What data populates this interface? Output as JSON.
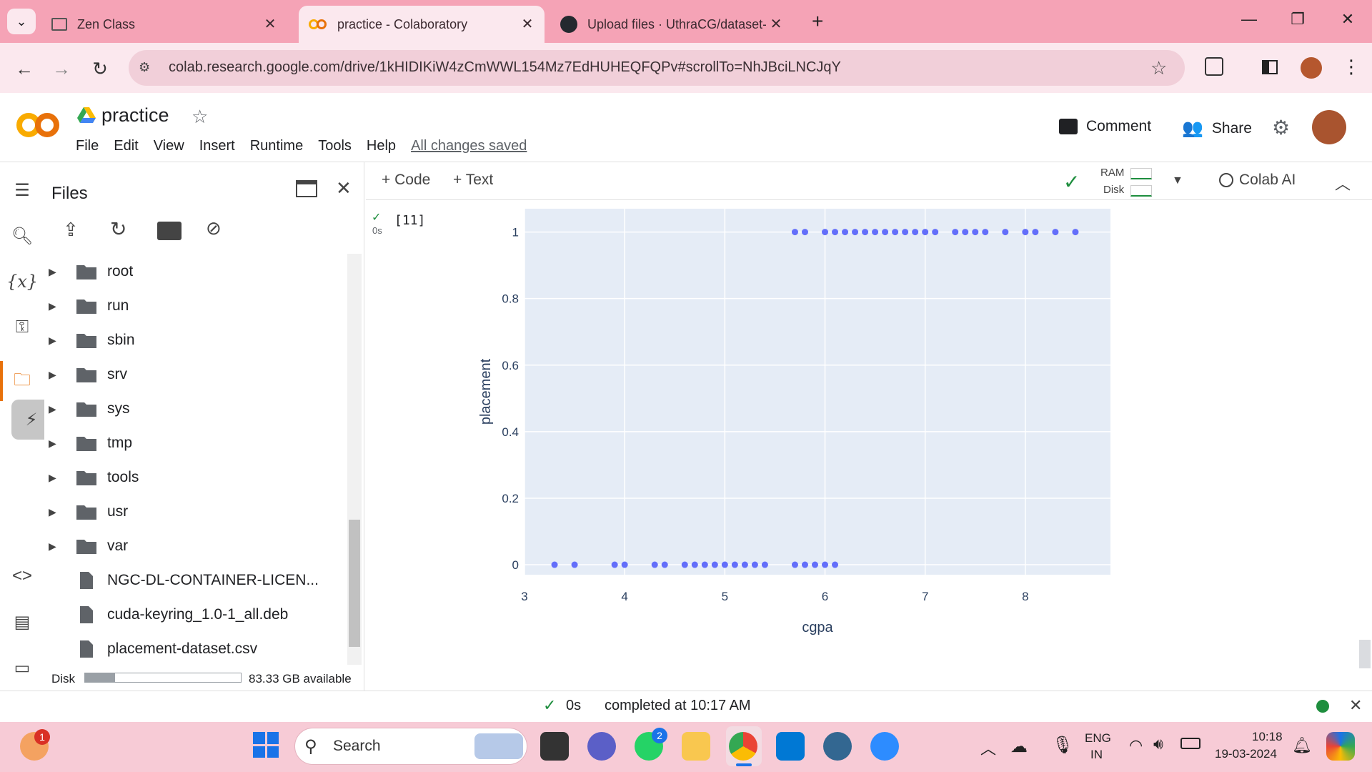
{
  "browser": {
    "tabs": [
      {
        "title": "Zen Class",
        "active": false
      },
      {
        "title": "practice - Colaboratory",
        "active": true
      },
      {
        "title": "Upload files · UthraCG/dataset-",
        "active": false
      }
    ],
    "url": "colab.research.google.com/drive/1kHIDIKiW4zCmWWL154Mz7EdHUHEQFQPv#scrollTo=NhJBciLNCJqY"
  },
  "colab": {
    "logo": "CO",
    "notebook_title": "practice",
    "menu": [
      "File",
      "Edit",
      "View",
      "Insert",
      "Runtime",
      "Tools",
      "Help"
    ],
    "saved_status": "All changes saved",
    "comment_label": "Comment",
    "share_label": "Share",
    "toolbar": {
      "code_label": "+ Code",
      "text_label": "+ Text",
      "ram_label": "RAM",
      "disk_label": "Disk",
      "colab_ai_label": "Colab AI"
    }
  },
  "files_panel": {
    "title": "Files",
    "folders": [
      "root",
      "run",
      "sbin",
      "srv",
      "sys",
      "tmp",
      "tools",
      "usr",
      "var"
    ],
    "files": [
      "NGC-DL-CONTAINER-LICEN...",
      "cuda-keyring_1.0-1_all.deb",
      "placement-dataset.csv"
    ],
    "disk_label": "Disk",
    "disk_used_fraction": 0.19,
    "disk_available": "83.33 GB available"
  },
  "cell": {
    "execution_count": "[11]",
    "exec_time": "0s"
  },
  "chart_data": {
    "type": "scatter",
    "xlabel": "cgpa",
    "ylabel": "placement",
    "xlim": [
      3,
      8.85
    ],
    "ylim": [
      -0.03,
      1.07
    ],
    "x_ticks": [
      "3",
      "4",
      "5",
      "6",
      "7",
      "8"
    ],
    "y_ticks": [
      "0",
      "0.2",
      "0.4",
      "0.6",
      "0.8",
      "1"
    ],
    "marker_color": "#636efa",
    "plot_bg": "#e5ecf6",
    "grid": true,
    "series": [
      {
        "x": [
          3.3,
          3.5,
          3.9,
          4.0,
          4.3,
          4.4,
          4.6,
          4.7,
          4.8,
          4.9,
          5.0,
          5.1,
          5.2,
          5.3,
          5.4,
          5.7,
          5.8,
          5.9,
          6.0,
          6.1,
          5.7,
          5.8,
          6.0,
          6.1,
          6.2,
          6.3,
          6.4,
          6.5,
          6.6,
          6.7,
          6.8,
          6.9,
          7.0,
          7.1,
          7.3,
          7.4,
          7.5,
          7.6,
          7.8,
          8.0,
          8.1,
          8.3,
          8.5
        ],
        "y": [
          0,
          0,
          0,
          0,
          0,
          0,
          0,
          0,
          0,
          0,
          0,
          0,
          0,
          0,
          0,
          0,
          0,
          0,
          0,
          0,
          1,
          1,
          1,
          1,
          1,
          1,
          1,
          1,
          1,
          1,
          1,
          1,
          1,
          1,
          1,
          1,
          1,
          1,
          1,
          1,
          1,
          1,
          1
        ]
      }
    ]
  },
  "status_bar": {
    "time": "0s",
    "text": "completed at 10:17 AM"
  },
  "taskbar": {
    "search_placeholder": "Search",
    "notification_count": "1",
    "whatsapp_badge": "2",
    "lang_line1": "ENG",
    "lang_line2": "IN",
    "clock_time": "10:18",
    "clock_date": "19-03-2024"
  }
}
